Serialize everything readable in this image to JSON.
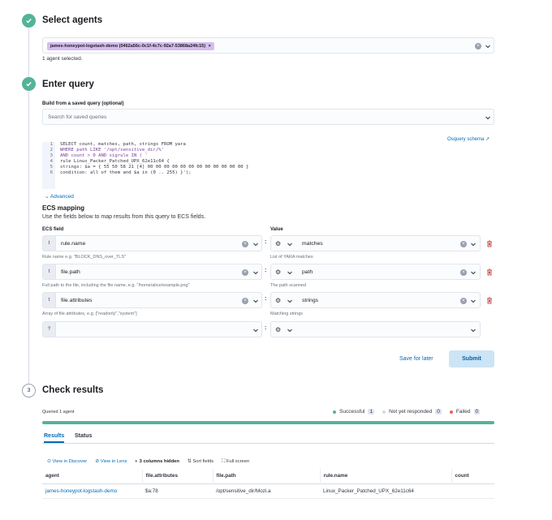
{
  "steps": {
    "select_agents": {
      "title": "Select agents",
      "agent_chip": "james-honeypot-logstash-demo (0462a56c-0c1f-4c7c-92a7-53868a24fc15)",
      "chip_close": "×",
      "selected_count": "1 agent selected."
    },
    "enter_query": {
      "title": "Enter query",
      "saved_query_label": "Build from a saved query (optional)",
      "saved_query_placeholder": "Search for saved queries",
      "schema_link": "Osquery schema",
      "code_lines": [
        {
          "n": "1",
          "t": "SELECT count, matches, path, strings FROM yara"
        },
        {
          "n": "2",
          "t": "WHERE path LIKE '/opt/sensitive_dir/%'"
        },
        {
          "n": "3",
          "t": "AND count > 0 AND sigrule IN ( '"
        },
        {
          "n": "4",
          "t": "rule Linux_Packer_Patched_UPX_62e11c64 {"
        },
        {
          "n": "5",
          "t": "strings: $a = { 55 50 58 21 [4] 00 00 00 00 00 00 00 00 00 00 00 00 }"
        },
        {
          "n": "6",
          "t": "condition: all of them and $a in (0 .. 255) }');"
        }
      ],
      "advanced_label": "Advanced",
      "ecs_title": "ECS mapping",
      "ecs_desc": "Use the fields below to map results from this query to ECS fields.",
      "ecs_field_header": "ECS field",
      "value_header": "Value",
      "rows": [
        {
          "type": "t",
          "field": "rule.name",
          "field_help": "Rule name e.g. \"BLOCK_DNS_over_TLS\"",
          "value": "matches",
          "value_help": "List of YARA matches"
        },
        {
          "type": "t",
          "field": "file.path",
          "field_help": "Full path to the file, including the file name. e.g. \"/home/alice/example.png\"",
          "value": "path",
          "value_help": "The path scanned"
        },
        {
          "type": "t",
          "field": "file.attributes",
          "field_help": "Array of file attributes, e.g. [\"readonly\",\"system\"]",
          "value": "strings",
          "value_help": "Matching strings"
        },
        {
          "type": "?",
          "field": "",
          "field_help": "",
          "value": "",
          "value_help": ""
        }
      ],
      "save_label": "Save for later",
      "submit_label": "Submit"
    },
    "check_results": {
      "step_number": "3",
      "title": "Check results",
      "queried": "Queried 1 agent",
      "successful_label": "Successful",
      "successful_count": "1",
      "pending_label": "Not yet responded",
      "pending_count": "0",
      "failed_label": "Failed",
      "failed_count": "0",
      "progress": 1.0,
      "tabs": [
        "Results",
        "Status"
      ],
      "toolbar": {
        "discover": "View in Discover",
        "lens": "View in Lens",
        "hidden": "3 columns hidden",
        "sort": "Sort fields",
        "fullscreen": "Full screen"
      },
      "columns": [
        "agent",
        "file.attributes",
        "file.path",
        "rule.name",
        "count"
      ],
      "rows": [
        [
          "james-honeypot-logstash-demo",
          "$a:78",
          "/opt/sensitive_dir/Mozi.a",
          "Linux_Packer_Patched_UPX_62e11c64",
          ""
        ]
      ]
    }
  },
  "colors": {
    "success": "#54b399",
    "accent": "#006bb8",
    "danger": "#bd271e",
    "chip": "#d6bcf0"
  }
}
